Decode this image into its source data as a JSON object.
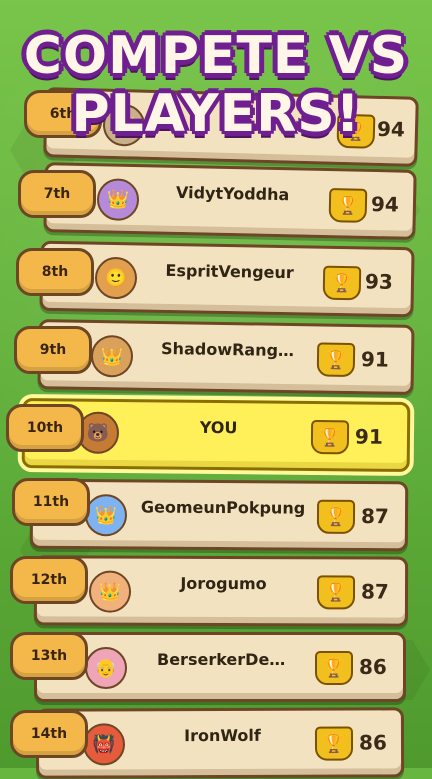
{
  "title": {
    "line1": "COMPETE VS",
    "line2": "PLAYERS!"
  },
  "leaderboard": {
    "rows": [
      {
        "rank": "6th",
        "name": "",
        "score": "94"
      },
      {
        "rank": "7th",
        "name": "VidytYoddha",
        "score": "94"
      },
      {
        "rank": "8th",
        "name": "EspritVengeur",
        "score": "93"
      },
      {
        "rank": "9th",
        "name": "ShadowRanger",
        "score": "91"
      },
      {
        "rank": "10th",
        "name": "YOU",
        "score": "91"
      },
      {
        "rank": "11th",
        "name": "GeomeunPokpung",
        "score": "87"
      },
      {
        "rank": "12th",
        "name": "Jorogumo",
        "score": "87"
      },
      {
        "rank": "13th",
        "name": "BerserkerDeFer",
        "score": "86"
      },
      {
        "rank": "14th",
        "name": "IronWolf",
        "score": "86"
      }
    ]
  },
  "icons": {
    "avatar": "crowned-king-avatar",
    "trophy": "trophy-icon"
  }
}
